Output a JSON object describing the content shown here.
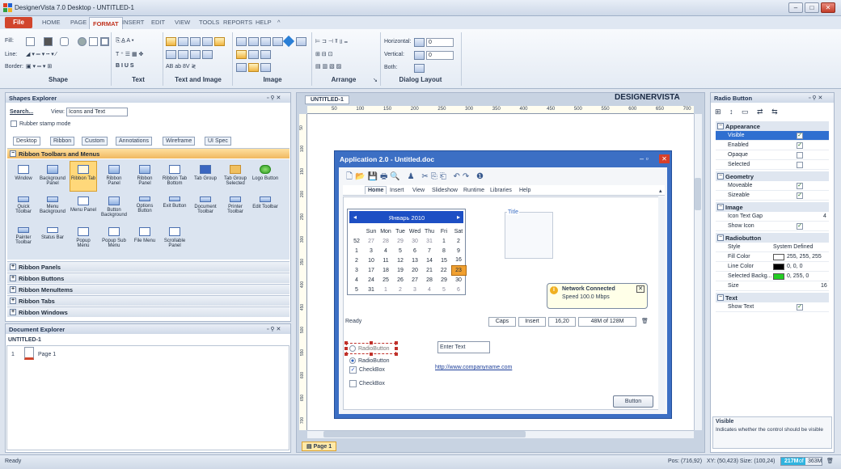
{
  "window": {
    "title": "DesignerVista 7.0  Desktop - UNTITLED-1"
  },
  "menu": {
    "file": "File",
    "tabs": [
      "HOME",
      "PAGE",
      "FORMAT",
      "INSERT",
      "EDIT",
      "VIEW",
      "TOOLS",
      "REPORTS",
      "HELP"
    ],
    "active": "FORMAT"
  },
  "ribbon": {
    "groups": [
      "Shape",
      "Text",
      "Text and Image",
      "Image",
      "Arrange",
      "Dialog Layout"
    ],
    "shape": {
      "fill": "Fill:",
      "line": "Line:",
      "border": "Border:"
    },
    "dialog": {
      "horizontal": "Horizontal:",
      "vertical": "Vertical:",
      "both": "Both:",
      "h_value": "0",
      "v_value": "0"
    },
    "text_row": "B  I  U  S    AB  ab  8V"
  },
  "shapes_explorer": {
    "title": "Shapes Explorer",
    "search": "Search...",
    "view_label": "View:",
    "view_value": "Icons and Text",
    "rubber_stamp": "Rubber stamp mode",
    "tabs": [
      "Desktop",
      "Ribbon",
      "Custom",
      "Annotations",
      "Wireframe",
      "UI Spec"
    ],
    "section_open": "Ribbon Toolbars and Menus",
    "tiles": [
      "Window",
      "Background Panel",
      "Ribbon Tab",
      "Ribbon Panel",
      "Ribbon Panel",
      "Ribbon Tab Bottom",
      "Tab Group",
      "Tab Group Selected",
      "Logo Button",
      "Quick Toolbar",
      "Menu Background",
      "Menu Panel",
      "Button Background",
      "Options Button",
      "Exit Button",
      "Document Toolbar",
      "Printer Toolbar",
      "Edit Toolbar",
      "Painter Toolbar",
      "Status Bar",
      "Popup Menu",
      "Popup Sub Menu",
      "File Menu",
      "Scrollable Panel"
    ],
    "sections": [
      "Ribbon Panels",
      "Ribbon Buttons",
      "Ribbon MenuItems",
      "Ribbon Tabs",
      "Ribbon Windows"
    ]
  },
  "doc_explorer": {
    "title": "Document Explorer",
    "doc": "UNTITLED-1",
    "page_num": "1",
    "page_label": "Page 1"
  },
  "canvas": {
    "tab": "UNTITLED-1",
    "brand": "DESIGNERVISTA",
    "ruler": [
      "50",
      "100",
      "150",
      "200",
      "250",
      "300",
      "350",
      "400",
      "450",
      "500",
      "550",
      "600",
      "650",
      "700"
    ],
    "vruler": [
      "50",
      "100",
      "150",
      "200",
      "250",
      "300",
      "350",
      "400",
      "450",
      "500",
      "550",
      "600",
      "650",
      "700"
    ],
    "page_tab": "Page 1"
  },
  "mock_app": {
    "title": "Application 2.0 - Untitled.doc",
    "menu": [
      "Home",
      "Insert",
      "View",
      "Slideshow",
      "Runtime",
      "Libraries",
      "Help"
    ],
    "calendar": {
      "month": "Январь 2010",
      "days": [
        "Sun",
        "Mon",
        "Tue",
        "Wed",
        "Thu",
        "Fri",
        "Sat"
      ],
      "rows": [
        [
          "52",
          "27",
          "28",
          "29",
          "30",
          "31",
          "1",
          "2"
        ],
        [
          "1",
          "3",
          "4",
          "5",
          "6",
          "7",
          "8",
          "9"
        ],
        [
          "2",
          "10",
          "11",
          "12",
          "13",
          "14",
          "15",
          "16"
        ],
        [
          "3",
          "17",
          "18",
          "19",
          "20",
          "21",
          "22",
          "23"
        ],
        [
          "4",
          "24",
          "25",
          "26",
          "27",
          "28",
          "29",
          "30"
        ],
        [
          "5",
          "31",
          "1",
          "2",
          "3",
          "4",
          "5",
          "6"
        ]
      ],
      "selected": "23"
    },
    "groupbox": "Title",
    "notification": {
      "title": "Network Connected",
      "body": "Speed 100.0 Mbps"
    },
    "status": {
      "ready": "Ready",
      "caps": "Caps",
      "insert": "Insert",
      "pos": "16,20",
      "mem": "48M of 128M"
    },
    "radio1": "RadioButton",
    "radio2": "RadioButton",
    "check1": "CheckBox",
    "check2": "CheckBox",
    "input_value": "Enter Text",
    "link": "http://www.companyname.com",
    "button": "Button"
  },
  "props": {
    "title": "Radio Button",
    "categories": {
      "appearance": "Appearance",
      "geometry": "Geometry",
      "image": "Image",
      "radiobutton": "Radiobutton",
      "text": "Text"
    },
    "rows": {
      "visible": "Visible",
      "enabled": "Enabled",
      "opaque": "Opaque",
      "selected": "Selected",
      "moveable": "Moveable",
      "sizeable": "Sizeable",
      "icon_gap": "Icon Text Gap",
      "icon_gap_val": "4",
      "show_icon": "Show Icon",
      "style": "Style",
      "style_val": "System Defined",
      "fill": "Fill Color",
      "fill_val": "255, 255, 255",
      "line": "Line Color",
      "line_val": "0, 0, 0",
      "selbg": "Selected Backg...",
      "selbg_val": "0, 255, 0",
      "size": "Size",
      "size_val": "16",
      "show_text": "Show Text"
    },
    "help_title": "Visible",
    "help_text": "Indicates whether the control should be visible"
  },
  "statusbar": {
    "ready": "Ready",
    "pos": "Pos: (716,92)",
    "xy": "XY: (50,423) Size: (100,24)",
    "mem1": "217M",
    "mem_of": "of",
    "mem2": "363M"
  },
  "colors": {
    "accent": "#d1452c",
    "selection": "#2f6fd0",
    "cal_header": "#1d4fc4",
    "cal_selected": "#f0a030",
    "green": "#22cc22"
  }
}
